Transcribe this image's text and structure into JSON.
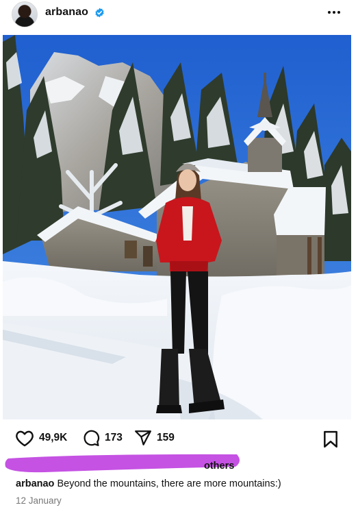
{
  "post": {
    "username": "arbanao",
    "verified": true,
    "more_icon": "more-horizontal-icon",
    "likes_count": "49,9K",
    "comments_count": "173",
    "shares_count": "159",
    "likes_text": "others",
    "caption_username": "arbanao",
    "caption_text": "Beyond the mountains, there are more mountains:)",
    "date": "12 January"
  },
  "colors": {
    "verified_badge": "#1d9bf0",
    "redaction_mark": "#c552e3",
    "sky": "#2d6fd6",
    "jacket": "#c8161c"
  }
}
